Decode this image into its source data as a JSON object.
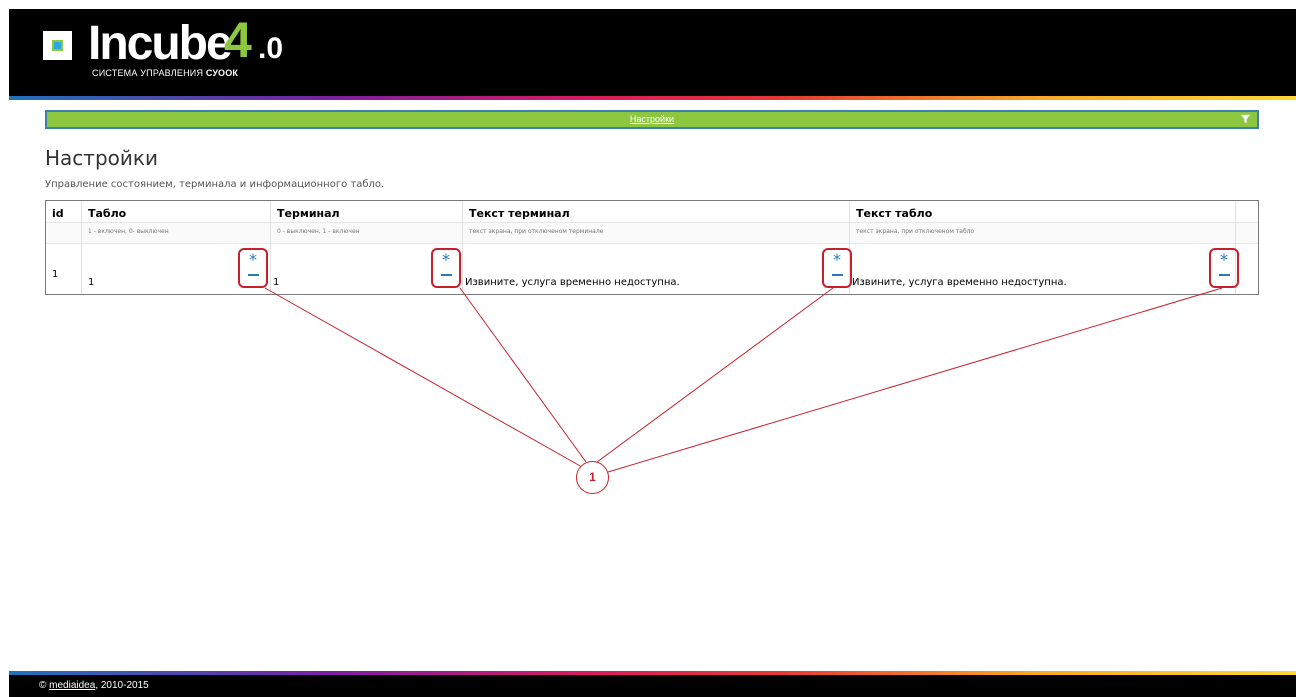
{
  "header": {
    "logo_text": "Incube",
    "logo_version_main": "4",
    "logo_version_sub": ".0",
    "subtitle_prefix": "СИСТЕМА УПРАВЛЕНИЯ",
    "subtitle_brand": "СУООК"
  },
  "navbar": {
    "link_label": "Настройки",
    "icon": "filter-icon"
  },
  "page": {
    "title": "Настройки",
    "description": "Управление состоянием, терминала и информационного табло."
  },
  "table": {
    "columns": [
      {
        "label": "id",
        "hint": ""
      },
      {
        "label": "Табло",
        "hint": "1 - включен, 0- выключен"
      },
      {
        "label": "Терминал",
        "hint": "0 - выключен, 1 - включен"
      },
      {
        "label": "Текст терминал",
        "hint": "текст экрана, при отключеном терминале"
      },
      {
        "label": "Текст табло",
        "hint": "текст экрана, при отключеном табло"
      }
    ],
    "rows": [
      {
        "id": "1",
        "tablo": "1",
        "terminal": "1",
        "text_terminal": "Извините, услуга временно недоступна.",
        "text_tablo": "Извините, услуга временно недоступна."
      }
    ],
    "control_star": "*"
  },
  "callout": {
    "number": "1",
    "color": "#c8202a"
  },
  "footer": {
    "copyright": "©",
    "link": "mediaidea",
    "years": ", 2010-2015"
  },
  "colors": {
    "navbar": "#8dc63f",
    "accent_blue": "#2a7ab8",
    "header_bg": "#000000"
  }
}
